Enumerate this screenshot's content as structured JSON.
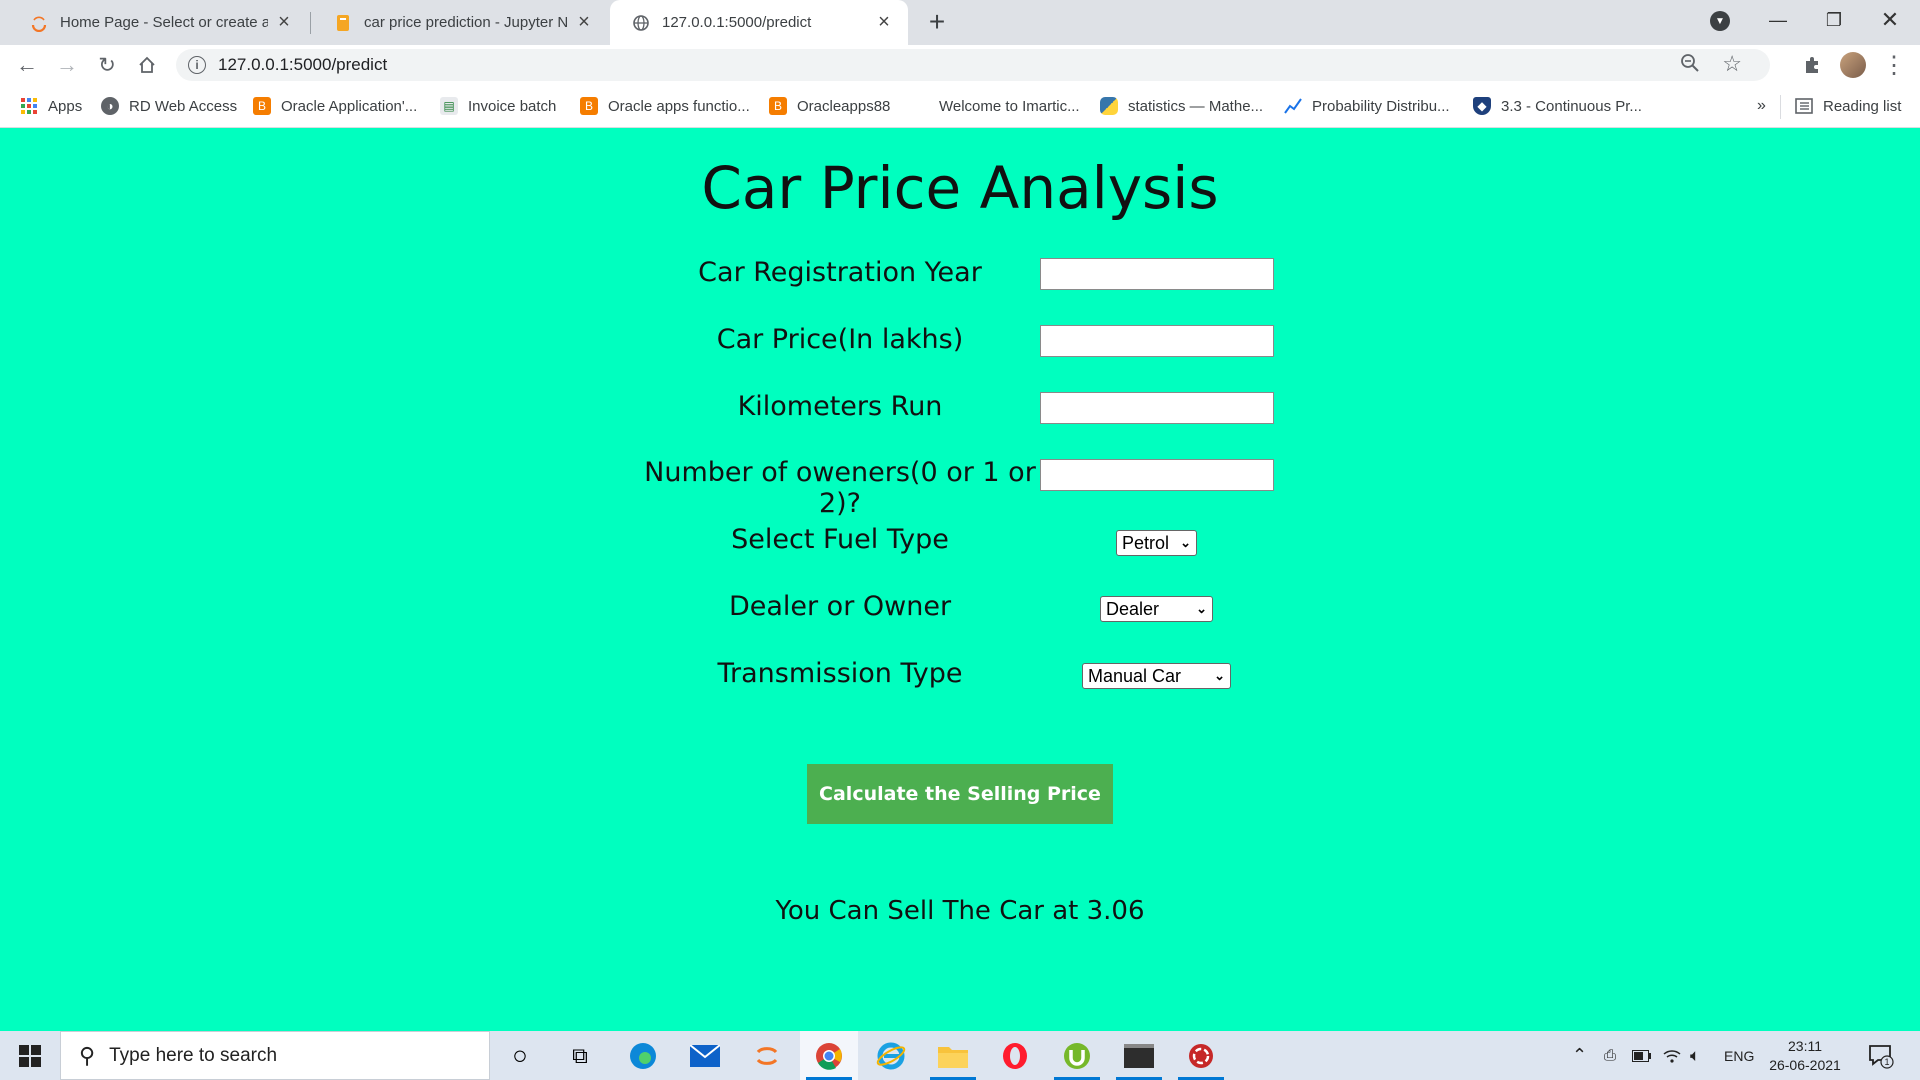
{
  "browser": {
    "tabs": [
      {
        "title": "Home Page - Select or create a n",
        "active": false
      },
      {
        "title": "car price prediction - Jupyter No",
        "active": false
      },
      {
        "title": "127.0.0.1:5000/predict",
        "active": true
      }
    ],
    "url": "127.0.0.1:5000/predict",
    "bookmarks": [
      {
        "label": "Apps",
        "icon": "apps-grid-icon"
      },
      {
        "label": "RD Web Access",
        "icon": "globe-icon"
      },
      {
        "label": "Oracle Application'...",
        "icon": "blogger-icon"
      },
      {
        "label": "Invoice batch",
        "icon": "sheet-icon"
      },
      {
        "label": "Oracle apps functio...",
        "icon": "blogger-icon"
      },
      {
        "label": "Oracleapps88",
        "icon": "blogger-icon"
      },
      {
        "label": "Welcome to Imartic...",
        "icon": "none"
      },
      {
        "label": "statistics — Mathe...",
        "icon": "python-icon"
      },
      {
        "label": "Probability Distribu...",
        "icon": "chart-icon"
      },
      {
        "label": "3.3 - Continuous Pr...",
        "icon": "shield-icon"
      }
    ],
    "overflow_label": "»",
    "reading_list_label": "Reading list"
  },
  "page": {
    "title": "Car Price Analysis",
    "fields": [
      {
        "label": "Car Registration Year",
        "value": ""
      },
      {
        "label": "Car Price(In lakhs)",
        "value": ""
      },
      {
        "label": "Kilometers Run",
        "value": ""
      },
      {
        "label": "Number of oweners(0 or 1 or 2)?",
        "value": ""
      }
    ],
    "selects": [
      {
        "label": "Select Fuel Type",
        "value": "Petrol"
      },
      {
        "label": "Dealer or Owner",
        "value": "Dealer"
      },
      {
        "label": "Transmission Type",
        "value": "Manual Car"
      }
    ],
    "submit_label": "Calculate the Selling Price",
    "result_text": "You Can Sell The Car at 3.06"
  },
  "taskbar": {
    "search_placeholder": "Type here to search",
    "language": "ENG",
    "time": "23:11",
    "date": "26-06-2021",
    "notification_count": "1"
  },
  "colors": {
    "page_bg": "#00ffbf",
    "button_bg": "#4caf50"
  }
}
